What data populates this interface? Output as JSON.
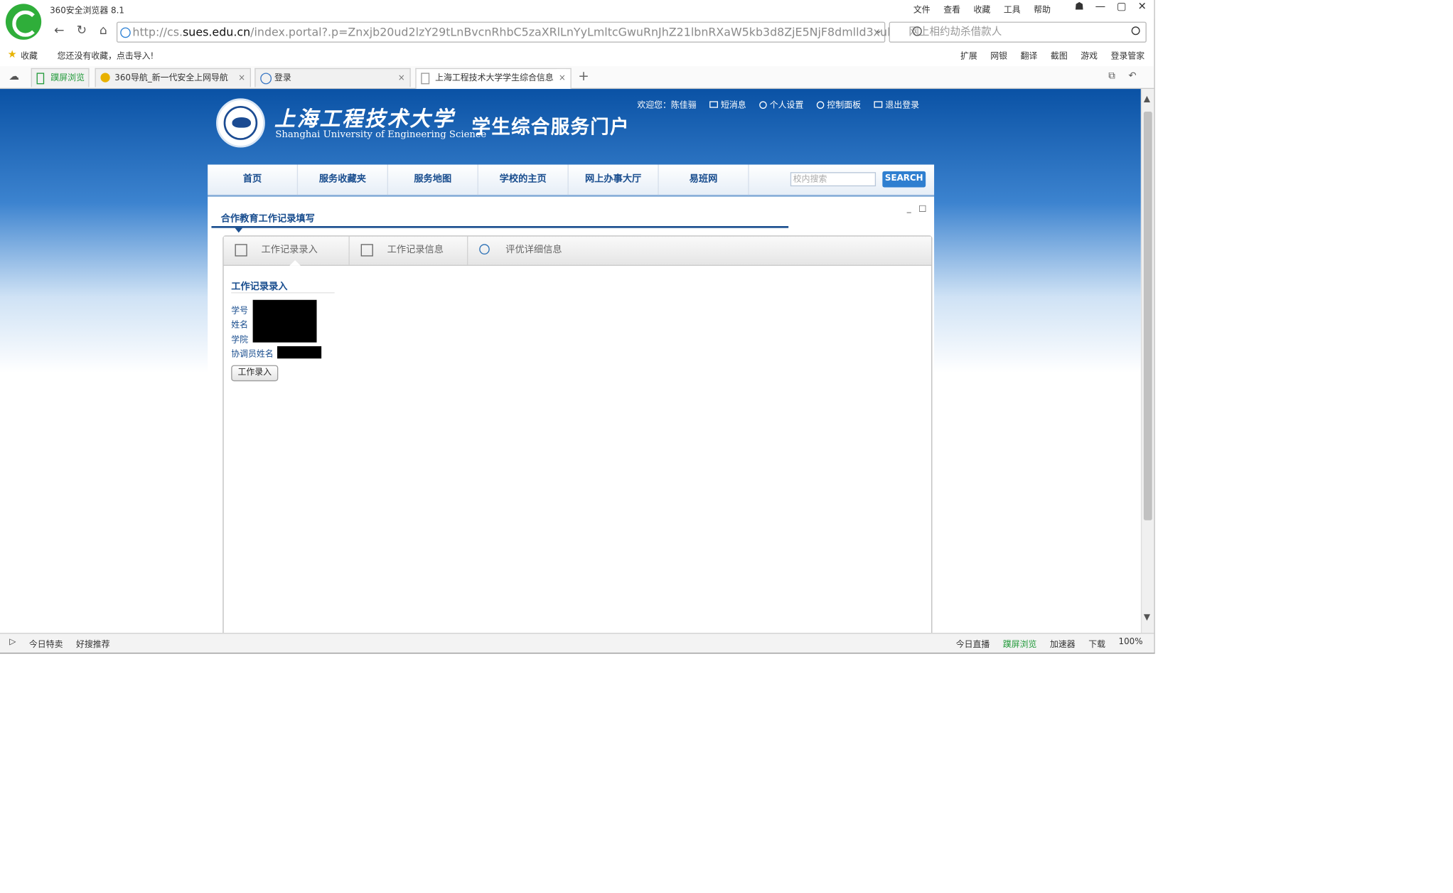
{
  "browser": {
    "app_title": "360安全浏览器 8.1",
    "menu": [
      "文件",
      "查看",
      "收藏",
      "工具",
      "帮助"
    ],
    "window_controls": [
      "☗",
      "—",
      "▢",
      "✕"
    ],
    "address": {
      "url_prefix": "http://cs.",
      "url_domain": "sues.edu.cn",
      "url_rest": "/index.portal?.p=Znxjb20ud2lzY29tLnBvcnRhbC5zaXRlLnYyLmltcGwuRnJhZ21lbnRXaW5kb3d8ZjE5NjF8dmlld3xub"
    },
    "search_placeholder": "网上相约劫杀借款人",
    "bookmarks": {
      "fav_label": "收藏",
      "hint": "您还没有收藏，点击导入!"
    },
    "toolbar": [
      "扩展",
      "网银",
      "翻译",
      "截图",
      "游戏",
      "登录管家"
    ],
    "tabs": [
      {
        "label": "蹼屏浏览",
        "kind": "special"
      },
      {
        "label": "360导航_新一代安全上网导航",
        "kind": "normal"
      },
      {
        "label": "登录",
        "kind": "normal"
      },
      {
        "label": "上海工程技术大学学生综合信息",
        "kind": "active"
      }
    ],
    "status": {
      "left": [
        "今日特卖",
        "好搜推荐"
      ],
      "right": [
        "今日直播",
        "蹼屏浏览",
        "加速器",
        "下载",
        "100%"
      ]
    }
  },
  "portal": {
    "school_name_cn": "上海工程技术大学",
    "school_name_en": "Shanghai University of Engineering Science",
    "portal_name": "学生综合服务门户",
    "welcome": "欢迎您：陈佳骊",
    "top_links": [
      "短消息",
      "个人设置",
      "控制面板",
      "退出登录"
    ],
    "nav": [
      "首页",
      "服务收藏夹",
      "服务地图",
      "学校的主页",
      "网上办事大厅",
      "易班网"
    ],
    "site_search_placeholder": "校内搜索",
    "search_button": "SEARCH",
    "panel_title": "合作教育工作记录填写",
    "panel_controls": [
      "_",
      "□"
    ],
    "tabs": [
      "工作记录录入",
      "工作记录信息",
      "评优详细信息"
    ],
    "form_title": "工作记录录入",
    "fields": [
      "学号",
      "姓名",
      "学院",
      "协调员姓名"
    ],
    "submit_label": "工作录入"
  }
}
